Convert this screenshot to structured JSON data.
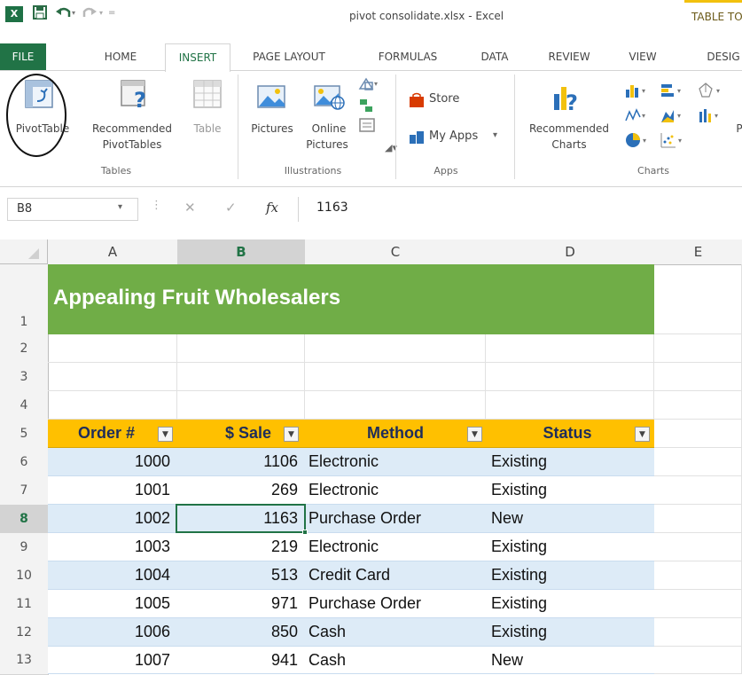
{
  "window": {
    "title": "pivot consolidate.xlsx - Excel",
    "context_tab": "TABLE TO",
    "app_logo": "X"
  },
  "tabs": [
    {
      "label": "FILE"
    },
    {
      "label": "HOME"
    },
    {
      "label": "INSERT"
    },
    {
      "label": "PAGE LAYOUT"
    },
    {
      "label": "FORMULAS"
    },
    {
      "label": "DATA"
    },
    {
      "label": "REVIEW"
    },
    {
      "label": "VIEW"
    },
    {
      "label": "DESIG"
    }
  ],
  "ribbon": {
    "pivottable": "PivotTable",
    "recommended_pivottables_1": "Recommended",
    "recommended_pivottables_2": "PivotTables",
    "table": "Table",
    "tables_group": "Tables",
    "pictures": "Pictures",
    "online_pictures_1": "Online",
    "online_pictures_2": "Pictures",
    "illustrations_group": "Illustrations",
    "store": "Store",
    "my_apps": "My Apps",
    "apps_group": "Apps",
    "recommended_charts_1": "Recommended",
    "recommended_charts_2": "Charts",
    "charts_group": "Charts",
    "cut_letter": "P"
  },
  "formula_bar": {
    "name_box": "B8",
    "fx": "fx",
    "value": "1163"
  },
  "columns": [
    "A",
    "B",
    "C",
    "D",
    "E"
  ],
  "row_numbers": [
    "1",
    "2",
    "3",
    "4",
    "5",
    "6",
    "7",
    "8",
    "9",
    "10",
    "11",
    "12",
    "13"
  ],
  "sheet": {
    "title": "Appealing Fruit Wholesalers",
    "headers": [
      "Order #",
      "$ Sale",
      "Method",
      "Status"
    ],
    "rows": [
      [
        "1000",
        "1106",
        "Electronic",
        "Existing"
      ],
      [
        "1001",
        "269",
        "Electronic",
        "Existing"
      ],
      [
        "1002",
        "1163",
        "Purchase Order",
        "New"
      ],
      [
        "1003",
        "219",
        "Electronic",
        "Existing"
      ],
      [
        "1004",
        "513",
        "Credit Card",
        "Existing"
      ],
      [
        "1005",
        "971",
        "Purchase Order",
        "Existing"
      ],
      [
        "1006",
        "850",
        "Cash",
        "Existing"
      ],
      [
        "1007",
        "941",
        "Cash",
        "New"
      ]
    ]
  },
  "colors": {
    "excel_green": "#217346",
    "title_banner": "#70ad47",
    "table_header": "#ffc000",
    "band_row": "#ddebf7"
  }
}
